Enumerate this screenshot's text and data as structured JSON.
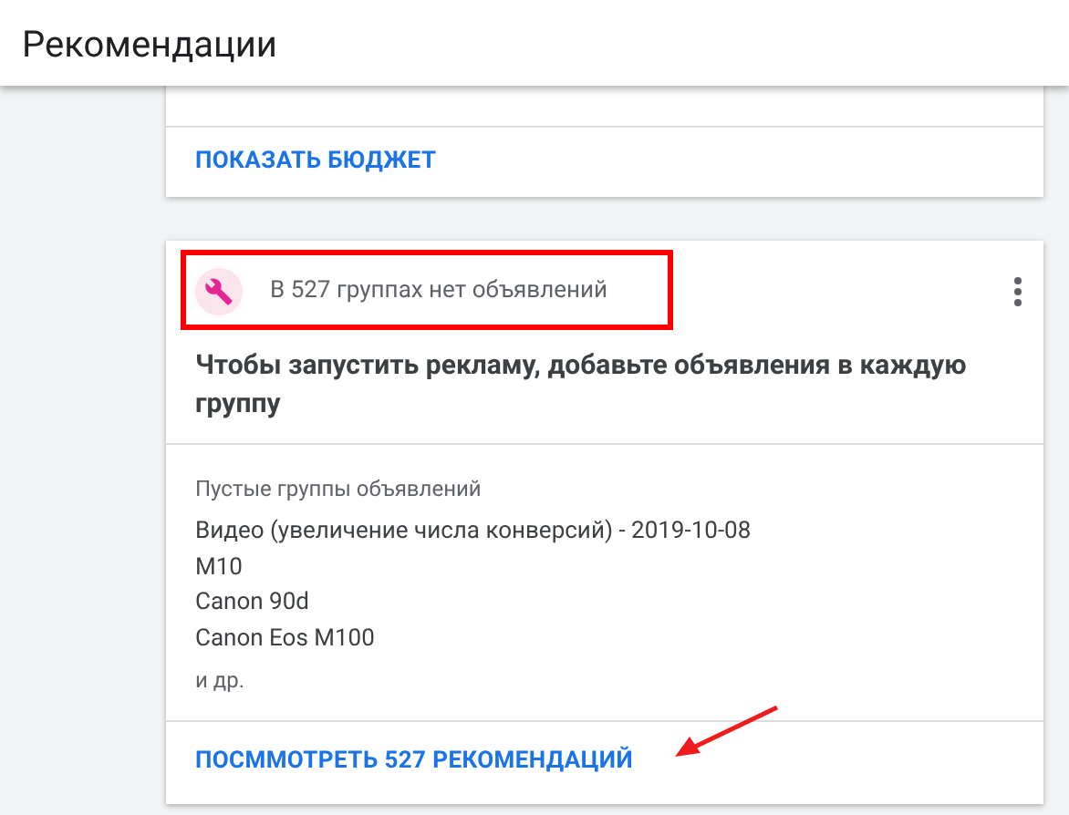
{
  "header": {
    "title": "Рекомендации"
  },
  "cards": [
    {
      "action": "ПОКАЗАТЬ БЮДЖЕТ"
    },
    {
      "status": "В 527 группах нет объявлений",
      "highlighted": true,
      "title": "Чтобы запустить рекламу, добавьте объявления в каждую группу",
      "list_label": "Пустые группы объявлений",
      "items": [
        "Видео (увеличение числа конверсий) - 2019-10-08",
        "M10",
        "Canon 90d",
        "Canon Eos M100"
      ],
      "more": "и др.",
      "action": "ПОСММОТРЕТЬ 527 РЕКОМЕНДАЦИЙ",
      "arrow": true
    }
  ]
}
